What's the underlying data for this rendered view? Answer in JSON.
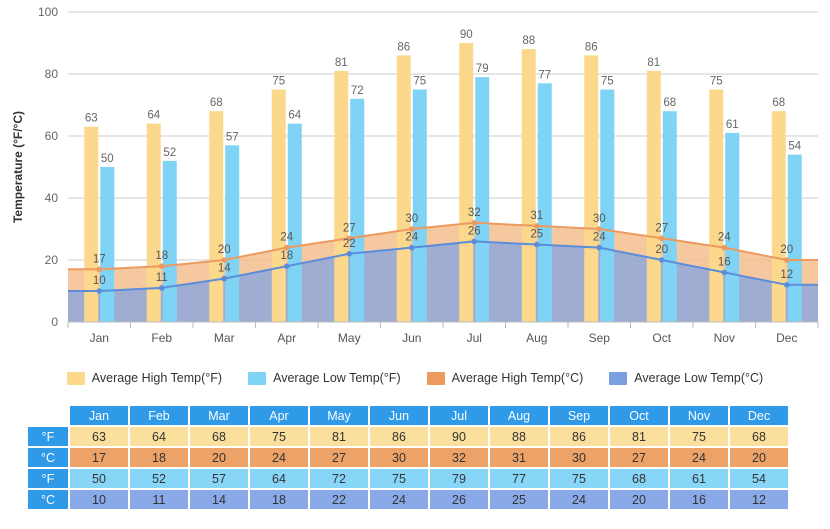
{
  "chart_data": {
    "type": "bar",
    "title": "",
    "xlabel": "",
    "ylabel": "Temperature (°F/°C)",
    "ylim": [
      0,
      100
    ],
    "yticks": [
      0,
      20,
      40,
      60,
      80,
      100
    ],
    "grid": true,
    "legend_position": "bottom",
    "categories": [
      "Jan",
      "Feb",
      "Mar",
      "Apr",
      "May",
      "Jun",
      "Jul",
      "Aug",
      "Sep",
      "Oct",
      "Nov",
      "Dec"
    ],
    "series": [
      {
        "name": "Average High Temp(°F)",
        "type": "bar",
        "color": "#fbd88b",
        "values": [
          63,
          64,
          68,
          75,
          81,
          86,
          90,
          88,
          86,
          81,
          75,
          68
        ]
      },
      {
        "name": "Average Low Temp(°F)",
        "type": "bar",
        "color": "#7fd4f5",
        "values": [
          50,
          52,
          57,
          64,
          72,
          75,
          79,
          77,
          75,
          68,
          61,
          54
        ]
      },
      {
        "name": "Average High Temp(°C)",
        "type": "area",
        "color": "#ec9a5f",
        "fill": "#f5be8e",
        "values": [
          17,
          18,
          20,
          24,
          27,
          30,
          32,
          31,
          30,
          27,
          24,
          20
        ]
      },
      {
        "name": "Average Low Temp(°C)",
        "type": "area",
        "color": "#5b8ddb",
        "fill": "#92a9d8",
        "values": [
          10,
          11,
          14,
          18,
          22,
          24,
          26,
          25,
          24,
          20,
          16,
          12
        ]
      }
    ]
  },
  "legend": {
    "items": [
      {
        "label": "Average High Temp(°F)",
        "color": "#fbd88b"
      },
      {
        "label": "Average Low Temp(°F)",
        "color": "#7fd4f5"
      },
      {
        "label": "Average High Temp(°C)",
        "color": "#ec9a5f"
      },
      {
        "label": "Average Low Temp(°C)",
        "color": "#7b9fe0"
      }
    ]
  },
  "table": {
    "corner": "",
    "columns": [
      "Jan",
      "Feb",
      "Mar",
      "Apr",
      "May",
      "Jun",
      "Jul",
      "Aug",
      "Sep",
      "Oct",
      "Nov",
      "Dec"
    ],
    "rows": [
      {
        "unit": "°F",
        "style": "c-hf",
        "values": [
          63,
          64,
          68,
          75,
          81,
          86,
          90,
          88,
          86,
          81,
          75,
          68
        ]
      },
      {
        "unit": "°C",
        "style": "c-hc",
        "values": [
          17,
          18,
          20,
          24,
          27,
          30,
          32,
          31,
          30,
          27,
          24,
          20
        ]
      },
      {
        "unit": "°F",
        "style": "c-lf",
        "values": [
          50,
          52,
          57,
          64,
          72,
          75,
          79,
          77,
          75,
          68,
          61,
          54
        ]
      },
      {
        "unit": "°C",
        "style": "c-lc",
        "values": [
          10,
          11,
          14,
          18,
          22,
          24,
          26,
          25,
          24,
          20,
          16,
          12
        ]
      }
    ]
  }
}
